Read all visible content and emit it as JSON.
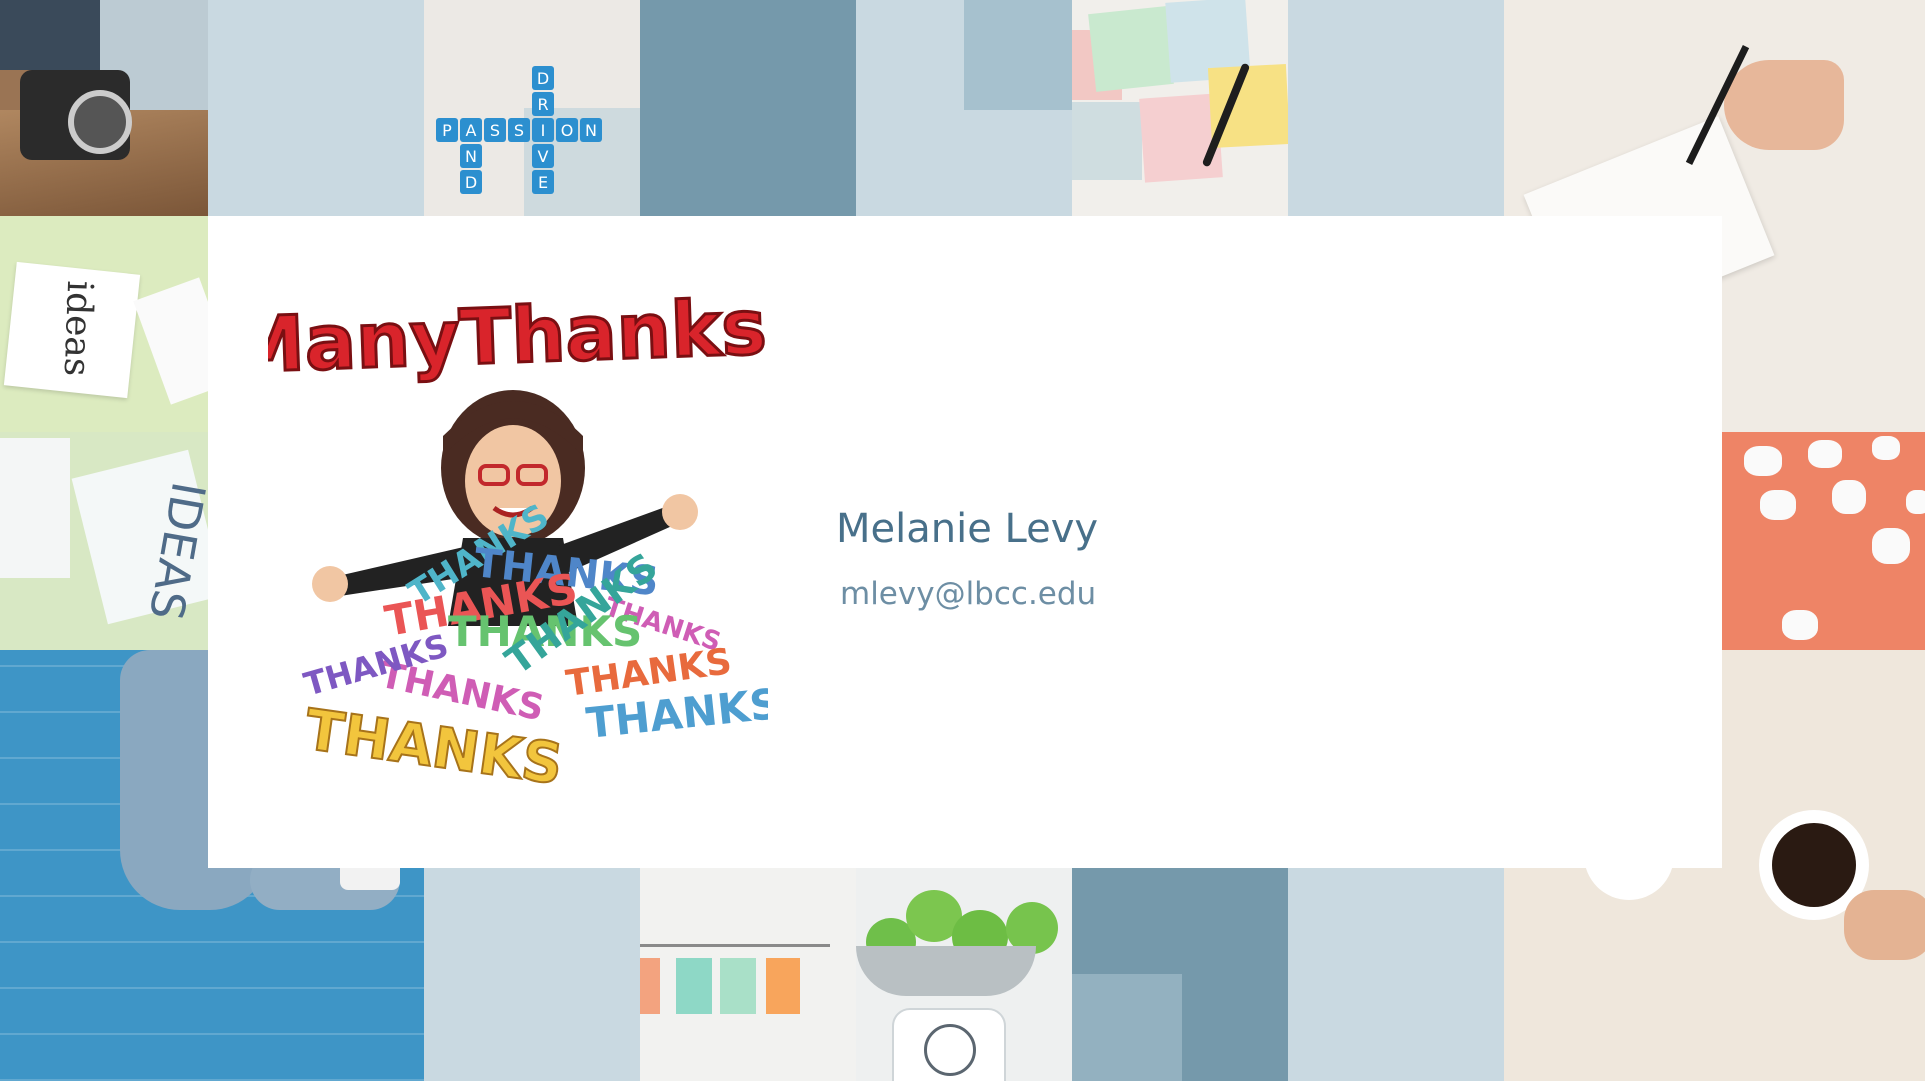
{
  "slide": {
    "sticker_heading": "ManyThanks!",
    "sticker_word": "THANKS",
    "presenter_name": "Melanie Levy",
    "presenter_email": "mlevy@lbcc.edu",
    "scrabble": {
      "horizontal": [
        "P",
        "A",
        "S",
        "S",
        "I",
        "O",
        "N"
      ],
      "drive": [
        "D",
        "R",
        "I",
        "V",
        "E"
      ],
      "and": [
        "A",
        "N",
        "D"
      ]
    },
    "note_cards": [
      "ideas",
      "IDEAS"
    ]
  },
  "colors": {
    "light_tile": "#c9d9e1",
    "mid_tile": "#7599ab",
    "accent_text": "#48708a",
    "coral": "#ee8466",
    "brick_blue": "#3e95c6"
  }
}
